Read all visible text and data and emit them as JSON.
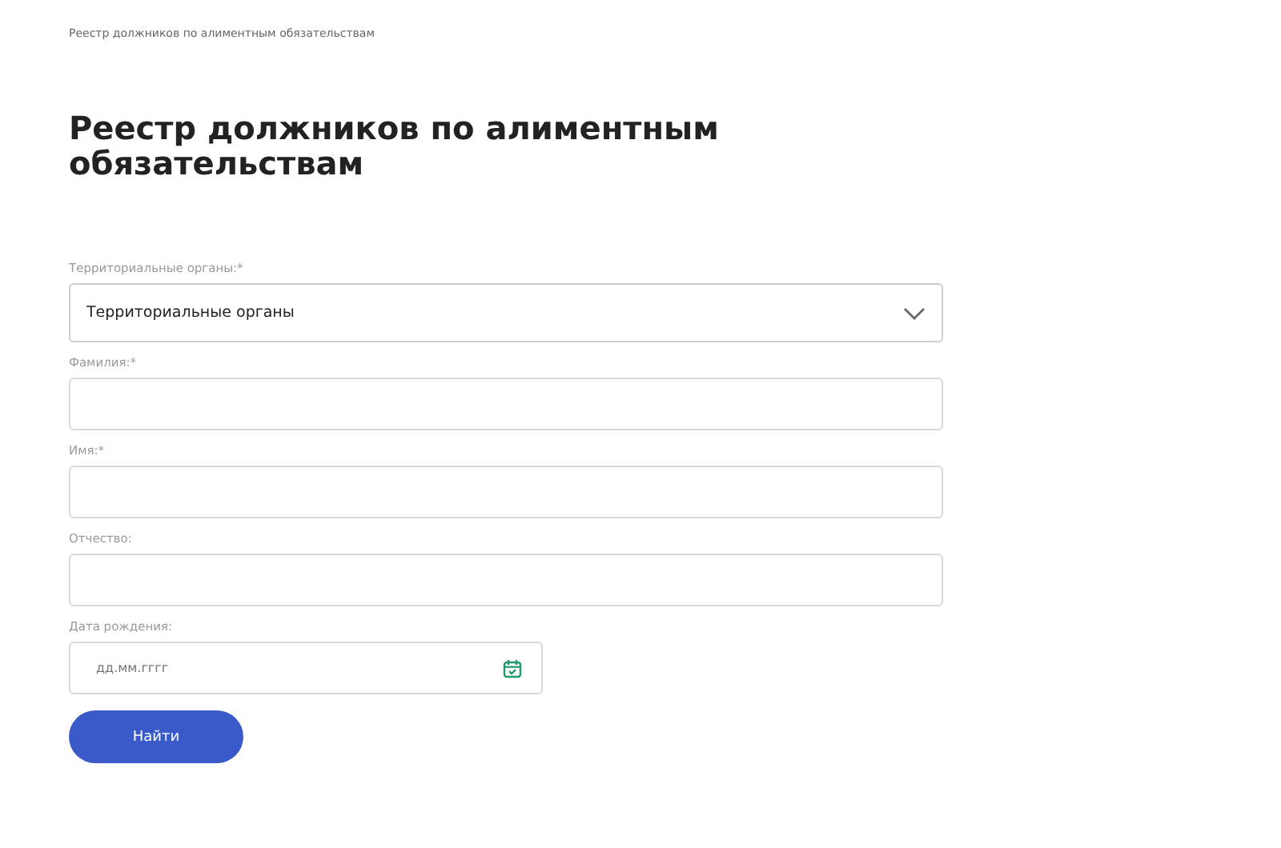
{
  "breadcrumb": "Реестр должников по алиментным обязательствам",
  "title": "Реестр должников по алиментным обязательствам",
  "fields": [
    {
      "kind": "select",
      "label": "Территориальные органы:*",
      "value": "Территориальные органы"
    },
    {
      "kind": "text",
      "label": "Фамилия:*"
    },
    {
      "kind": "text",
      "label": "Имя:*"
    },
    {
      "kind": "text",
      "label": "Отчество:"
    },
    {
      "kind": "date",
      "label": "Дата рождения:",
      "placeholder": "дд.мм.гггг"
    }
  ],
  "submit": "Найти"
}
